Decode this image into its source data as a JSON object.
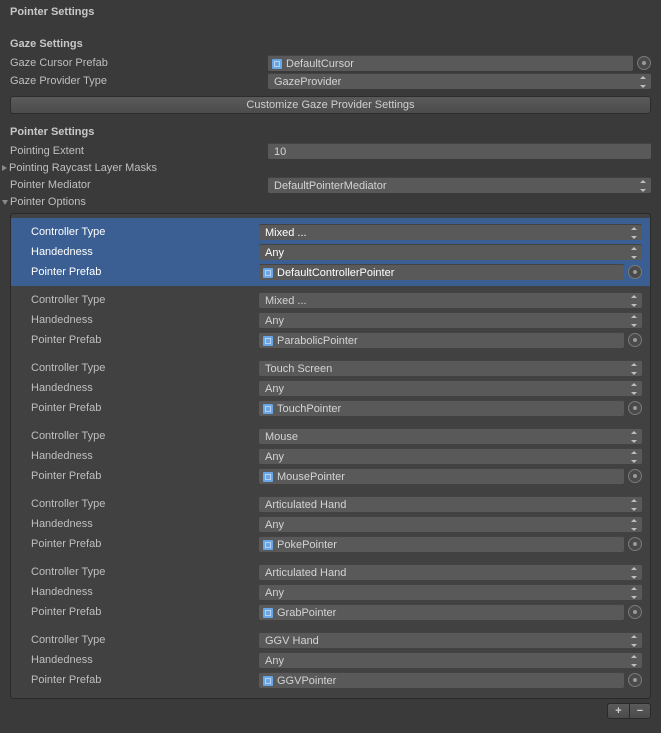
{
  "header_title": "Pointer Settings",
  "gaze": {
    "section_title": "Gaze Settings",
    "cursor_prefab_label": "Gaze Cursor Prefab",
    "cursor_prefab_value": "DefaultCursor",
    "provider_type_label": "Gaze Provider Type",
    "provider_type_value": "GazeProvider",
    "customize_button": "Customize Gaze Provider Settings"
  },
  "pointer": {
    "section_title": "Pointer Settings",
    "extent_label": "Pointing Extent",
    "extent_value": "10",
    "raycast_label": "Pointing Raycast Layer Masks",
    "mediator_label": "Pointer Mediator",
    "mediator_value": "DefaultPointerMediator",
    "options_label": "Pointer Options"
  },
  "labels": {
    "controller_type": "Controller Type",
    "handedness": "Handedness",
    "pointer_prefab": "Pointer Prefab"
  },
  "options": [
    {
      "controller": "Mixed ...",
      "handedness": "Any",
      "prefab": "DefaultControllerPointer",
      "selected": true
    },
    {
      "controller": "Mixed ...",
      "handedness": "Any",
      "prefab": "ParabolicPointer",
      "selected": false
    },
    {
      "controller": "Touch Screen",
      "handedness": "Any",
      "prefab": "TouchPointer",
      "selected": false
    },
    {
      "controller": "Mouse",
      "handedness": "Any",
      "prefab": "MousePointer",
      "selected": false
    },
    {
      "controller": "Articulated Hand",
      "handedness": "Any",
      "prefab": "PokePointer",
      "selected": false
    },
    {
      "controller": "Articulated Hand",
      "handedness": "Any",
      "prefab": "GrabPointer",
      "selected": false
    },
    {
      "controller": "GGV Hand",
      "handedness": "Any",
      "prefab": "GGVPointer",
      "selected": false
    }
  ],
  "footer": {
    "add": "+",
    "remove": "−"
  }
}
